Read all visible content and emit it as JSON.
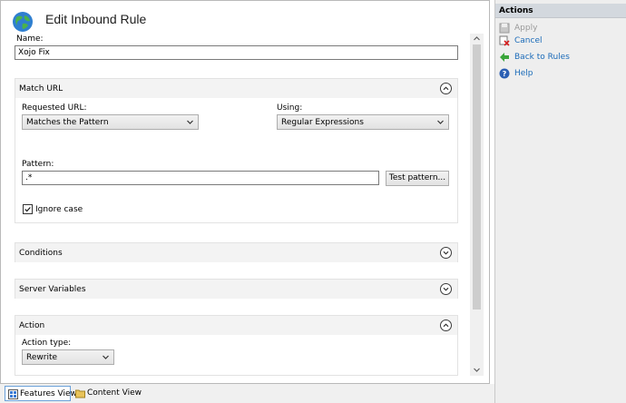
{
  "page": {
    "title": "Edit Inbound Rule"
  },
  "name_field": {
    "label": "Name:",
    "value": "Xojo Fix"
  },
  "match_url": {
    "title": "Match URL",
    "requested_url_label": "Requested URL:",
    "requested_url_value": "Matches the Pattern",
    "using_label": "Using:",
    "using_value": "Regular Expressions",
    "pattern_label": "Pattern:",
    "pattern_value": ".*",
    "test_button": "Test pattern...",
    "ignore_case_label": "Ignore case",
    "ignore_case_checked": true
  },
  "conditions": {
    "title": "Conditions"
  },
  "server_variables": {
    "title": "Server Variables"
  },
  "action": {
    "title": "Action",
    "action_type_label": "Action type:",
    "action_type_value": "Rewrite"
  },
  "actions_panel": {
    "title": "Actions",
    "items": [
      {
        "label": "Apply",
        "icon": "save-icon",
        "enabled": false
      },
      {
        "label": "Cancel",
        "icon": "cancel-icon",
        "enabled": true
      },
      {
        "label": "Back to Rules",
        "icon": "back-arrow-icon",
        "enabled": true
      },
      {
        "label": "Help",
        "icon": "help-icon",
        "enabled": true
      }
    ]
  },
  "bottom_tabs": [
    {
      "label": "Features View",
      "active": true
    },
    {
      "label": "Content View",
      "active": false
    }
  ],
  "colors": {
    "link": "#1b6bb9",
    "header": "#d3d8de",
    "accent_green": "#3aa53a"
  }
}
